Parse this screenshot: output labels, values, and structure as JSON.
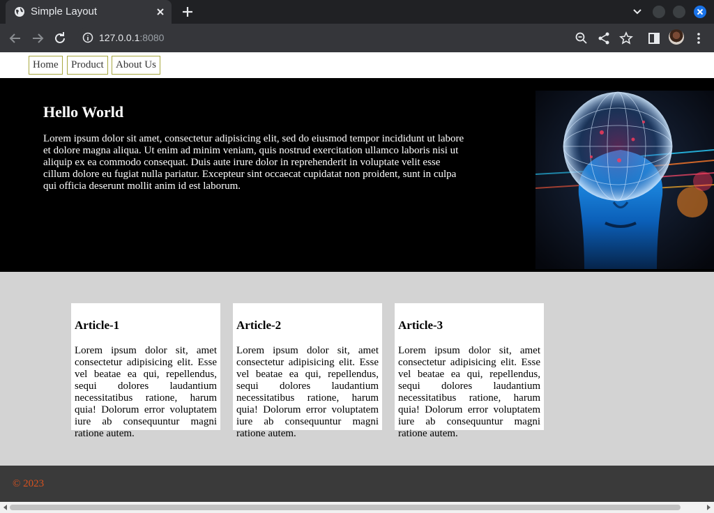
{
  "browser": {
    "tab_title": "Simple Layout",
    "url_host": "127.0.0.1",
    "url_port": ":8080",
    "icons": {
      "favicon": "globe-icon",
      "tab_close": "close-icon",
      "new_tab": "plus-icon",
      "tab_search": "chevron-down-icon",
      "back": "back-arrow-icon",
      "forward": "forward-arrow-icon",
      "reload": "reload-icon",
      "site_info": "info-icon",
      "zoom": "zoom-out-icon",
      "share": "share-icon",
      "bookmark": "star-icon",
      "side_panel": "side-panel-icon",
      "profile": "avatar",
      "menu": "kebab-menu-icon"
    },
    "accent_color": "#1a73e8"
  },
  "nav": {
    "items": [
      {
        "label": "Home"
      },
      {
        "label": "Product"
      },
      {
        "label": "About Us"
      }
    ],
    "border_color": "#a8a840"
  },
  "hero": {
    "title": "Hello World",
    "text": "Lorem ipsum dolor sit amet, consectetur adipisicing elit, sed do eiusmod tempor incididunt ut labore et dolore magna aliqua. Ut enim ad minim veniam, quis nostrud exercitation ullamco laboris nisi ut aliquip ex ea commodo consequat. Duis aute irure dolor in reprehenderit in voluptate velit esse cillum dolore eu fugiat nulla pariatur. Excepteur sint occaecat cupidatat non proident, sunt in culpa qui officia deserunt mollit anim id est laborum.",
    "background": "#000000"
  },
  "articles": [
    {
      "title": "Article-1",
      "text": "Lorem ipsum dolor sit, amet consectetur adipisicing elit. Esse vel beatae ea qui, repellendus, sequi dolores laudantium necessitatibus ratione, harum quia! Dolorum error voluptatem iure ab consequuntur magni ratione autem."
    },
    {
      "title": "Article-2",
      "text": "Lorem ipsum dolor sit, amet consectetur adipisicing elit. Esse vel beatae ea qui, repellendus, sequi dolores laudantium necessitatibus ratione, harum quia! Dolorum error voluptatem iure ab consequuntur magni ratione autem."
    },
    {
      "title": "Article-3",
      "text": "Lorem ipsum dolor sit, amet consectetur adipisicing elit. Esse vel beatae ea qui, repellendus, sequi dolores laudantium necessitatibus ratione, harum quia! Dolorum error voluptatem iure ab consequuntur magni ratione autem."
    }
  ],
  "footer": {
    "text": "© 2023",
    "text_color": "#d8521f"
  }
}
